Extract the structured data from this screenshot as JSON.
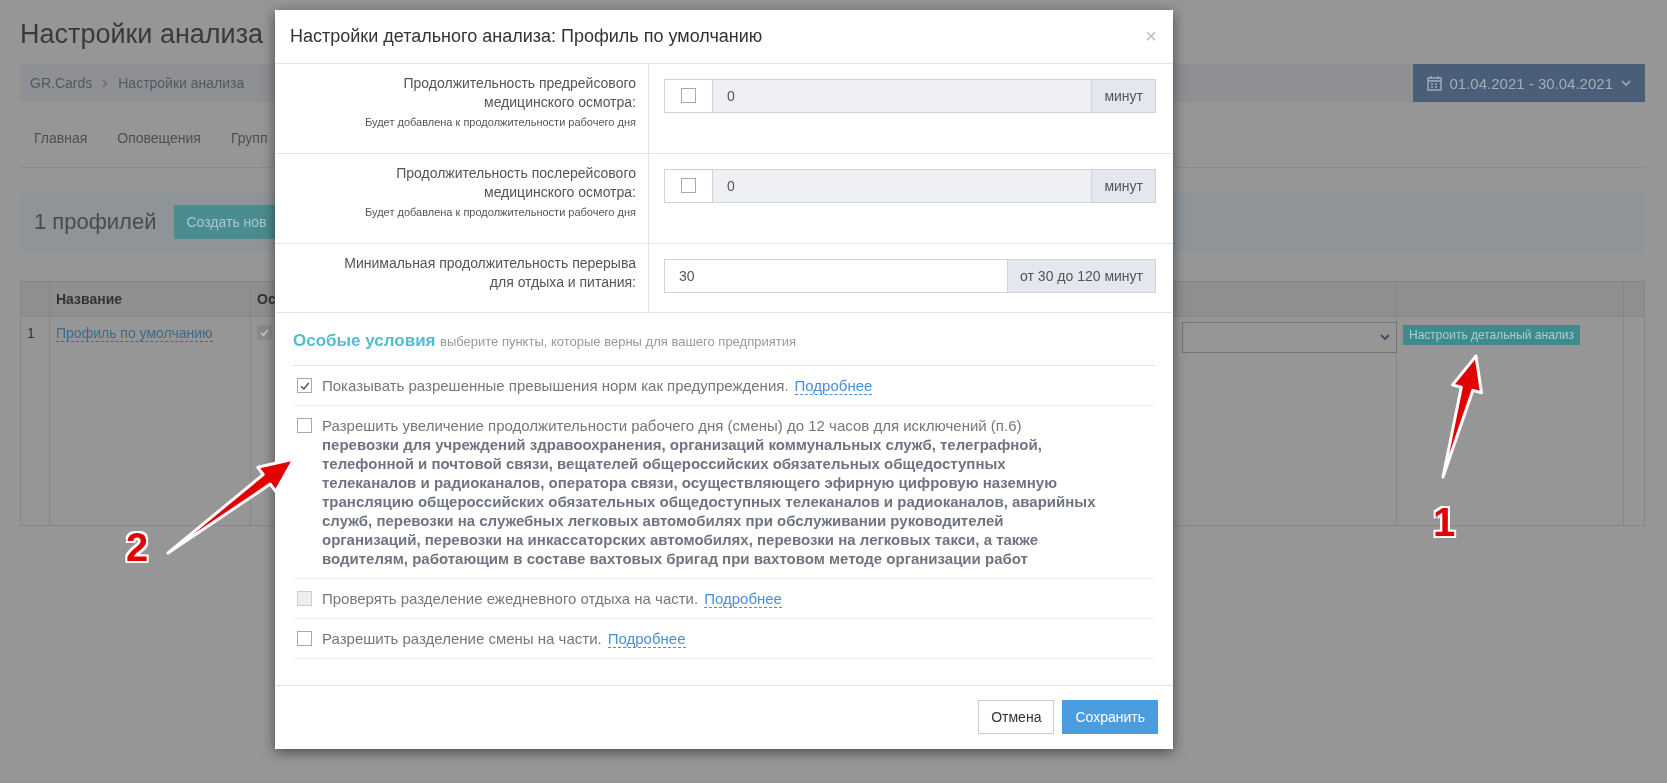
{
  "page": {
    "title": "Настройки анализа",
    "breadcrumbs": [
      "GR.Cards",
      "Настройки анализа"
    ],
    "date_range": "01.04.2021 -  30.04.2021",
    "tabs": [
      {
        "label": "Главная"
      },
      {
        "label": "Оповещения"
      },
      {
        "label": "Групп"
      }
    ],
    "profiles_count": "1 профилей",
    "create_button": "Создать нов",
    "table": {
      "columns": [
        "Название",
        "Ос"
      ],
      "rows": [
        {
          "index": "1",
          "name": "Профиль по умолчанию",
          "checked": true,
          "action": "Настроить детальный анализ"
        }
      ]
    }
  },
  "modal": {
    "title": "Настройки детального анализа: Профиль по умолчанию",
    "close": "×",
    "rows": [
      {
        "kind": "toggle-input",
        "label": "Продолжительность предрейсового медицинского осмотра:",
        "hint": "Будет добавлена к продолжительности рабочего дня",
        "checked": false,
        "value": "0",
        "unit": "минут"
      },
      {
        "kind": "toggle-input",
        "label": "Продолжительность послерейсового медицинского осмотра:",
        "hint": "Будет добавлена к продолжительности рабочего дня",
        "checked": false,
        "value": "0",
        "unit": "минут"
      },
      {
        "kind": "input",
        "label": "Минимальная продолжительность перерыва для отдыха и питания:",
        "value": "30",
        "unit": "от 30 до 120 минут"
      }
    ],
    "section_title": "Особые условия",
    "section_subtitle": "выберите пункты, которые верны для вашего предприятия",
    "options": [
      {
        "text": "Показывать разрешенные превышения норм как предупреждения.",
        "link": "Подробнее",
        "checked": true,
        "disabled": false
      },
      {
        "text": "Разрешить увеличение продолжительности рабочего дня (смены) до 12 часов для исключений (п.6)  **перевозки для учреждений здравоохранения, организаций коммунальных служб, телеграфной, телефонной и почтовой связи, вещателей общероссийских обязательных общедоступных телеканалов и радиоканалов, оператора связи, осуществляющего эфирную цифровую наземную трансляцию общероссийских обязательных общедоступных телеканалов и радиоканалов, аварийных служб, перевозки на служебных легковых автомобилях при обслуживании руководителей организаций, перевозки на инкассаторских автомобилях, перевозки на легковых такси, а также водителям, работающим в составе вахтовых бригад при вахтовом методе организации работ**",
        "checked": false,
        "disabled": false
      },
      {
        "text": "Проверять разделение ежедневного отдыха на части.",
        "link": "Подробнее",
        "checked": false,
        "disabled": true
      },
      {
        "text": "Разрешить разделение смены на части.",
        "link": "Подробнее",
        "checked": false,
        "disabled": false
      }
    ],
    "buttons": [
      {
        "kind": "secondary",
        "label": "Отмена"
      },
      {
        "kind": "primary",
        "label": "Сохранить"
      }
    ]
  },
  "annotations": [
    {
      "label": "1"
    },
    {
      "label": "2"
    }
  ]
}
